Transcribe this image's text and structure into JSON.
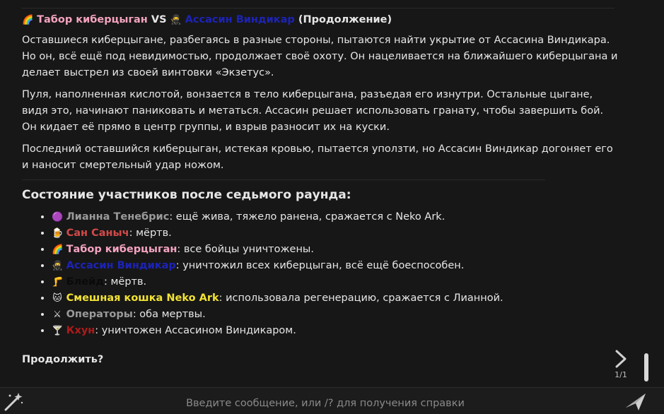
{
  "message": {
    "title": {
      "emoji1": "🌈",
      "name1": "Табор киберцыган",
      "vs": " VS ",
      "emoji2": "🥷",
      "name2": "Ассасин Виндикар",
      "suffix": " (Продолжение)"
    },
    "paragraphs": [
      "Оставшиеся киберцыгане, разбегаясь в разные стороны, пытаются найти укрытие от Ассасина Виндикара. Но он, всё ещё под невидимостью, продолжает своё охоту. Он нацеливается на ближайшего киберцыгана и делает выстрел из своей винтовки «Экзетус».",
      "Пуля, наполненная кислотой, вонзается в тело киберцыгана, разъедая его изнутри. Остальные цыгане, видя это, начинают паниковать и метаться. Ассасин решает использовать гранату, чтобы завершить бой. Он кидает её прямо в центр группы, и взрыв разносит их на куски.",
      "Последний оставшийся киберцыган, истекая кровью, пытается уползти, но Ассасин Виндикар догоняет его и наносит смертельный удар ножом."
    ],
    "status_heading": "Состояние участников после седьмого раунда:",
    "participants": [
      {
        "emoji": "🟣",
        "name": "Лианна Тенебрис",
        "status": ": ещё жива, тяжело ранена, сражается с Neko Ark."
      },
      {
        "emoji": "🍺",
        "name": "Сан Саныч",
        "status": ": мёртв."
      },
      {
        "emoji": "🌈",
        "name": "Табор киберцыган",
        "status": ": все бойцы уничтожены."
      },
      {
        "emoji": "🥷",
        "name": "Ассасин Виндикар",
        "status": ": уничтожил всех киберцыган, всё ещё боеспособен."
      },
      {
        "emoji": "🦵",
        "name": "Блейд",
        "status": ": мёртв."
      },
      {
        "emoji": "🐱",
        "name": "Смешная кошка Neko Ark",
        "status": ": использовала регенерацию, сражается с Лианной."
      },
      {
        "emoji": "⚔",
        "name": "Операторы",
        "status": ": оба мертвы."
      },
      {
        "emoji": "🍸",
        "name": "Кхун",
        "status": ": уничтожен Ассасином Виндикаром."
      }
    ],
    "continue_text": "Продолжить?"
  },
  "swipe": {
    "counter": "1/1"
  },
  "input": {
    "placeholder": "Введите сообщение, или /? для получения справки"
  },
  "icons": {
    "wand": "magic-wand-icon",
    "send": "send-icon",
    "swipe": "chevron-right-icon"
  },
  "colors": {
    "background": "#171717",
    "tabor": "#f4a3c0",
    "assassin": "#1c23b8",
    "lianna": "#9a9a9a",
    "san": "#d24a4a",
    "blade": "#0a0a0a",
    "cat": "#f2e234",
    "operators": "#9a9a9a",
    "khuy": "#b01a1a"
  }
}
